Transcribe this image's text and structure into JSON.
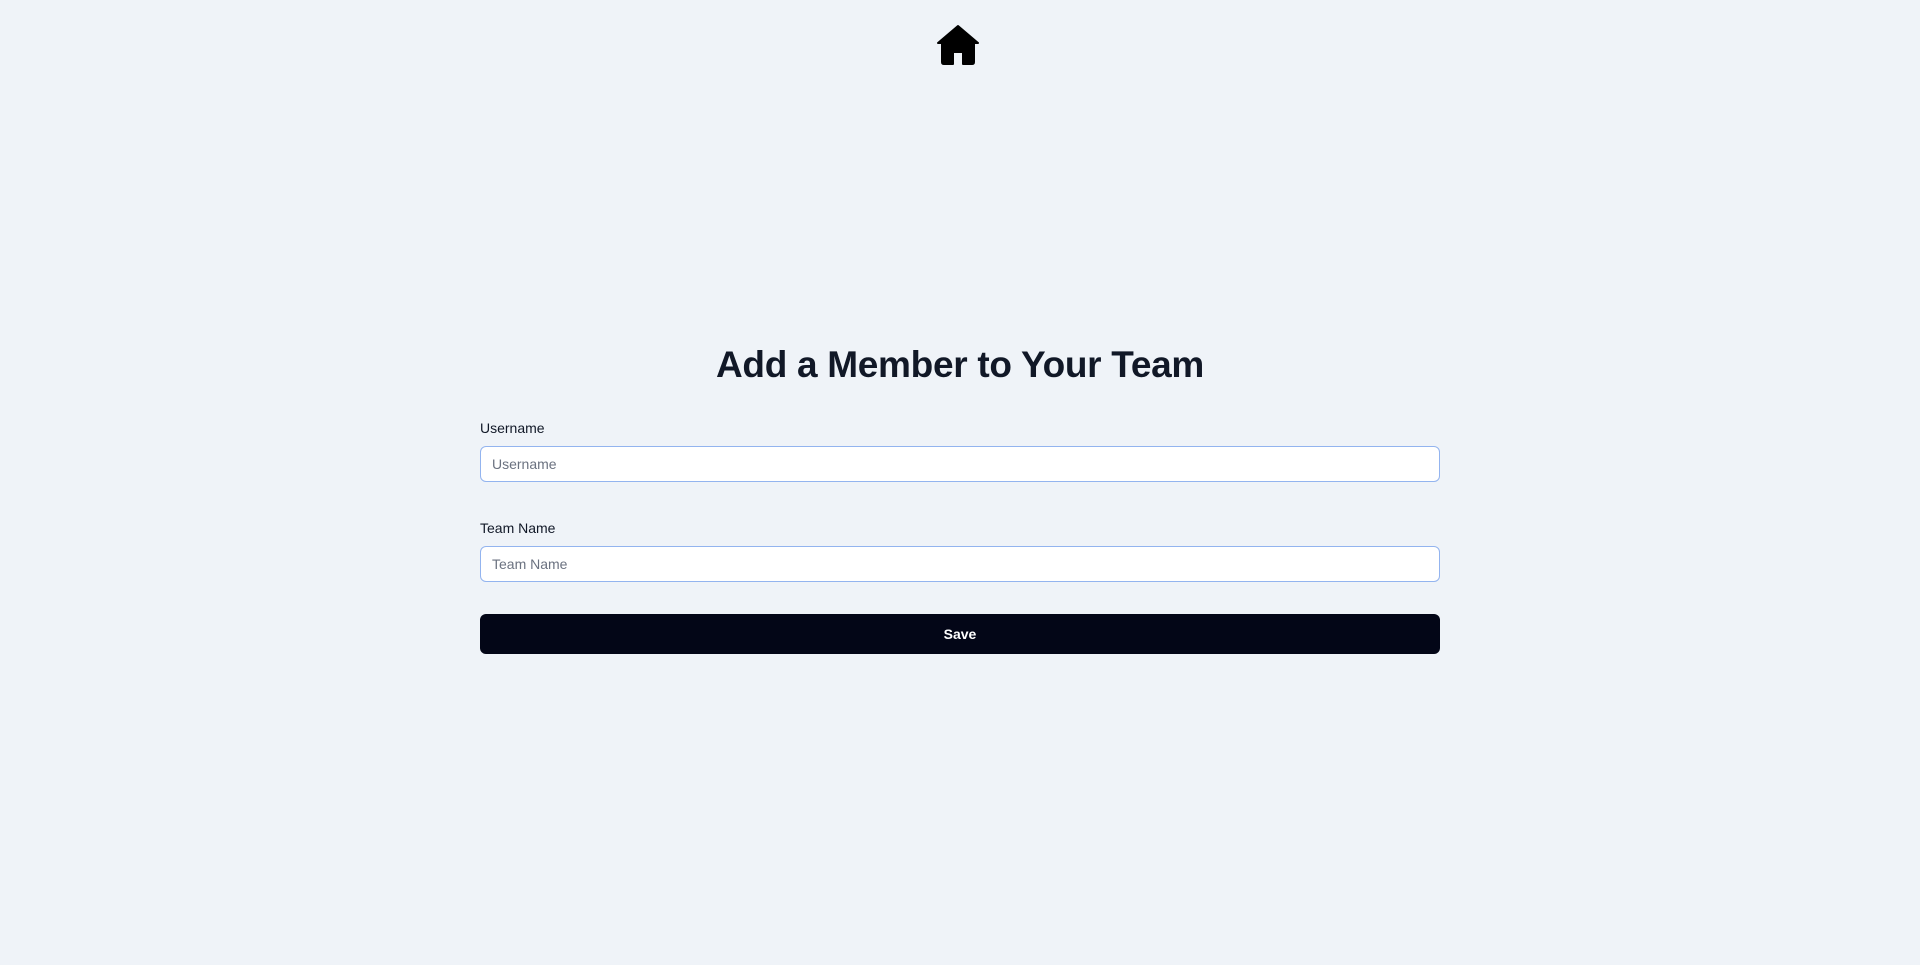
{
  "nav": {
    "home_icon": "home-icon"
  },
  "form": {
    "title": "Add a Member to Your Team",
    "username": {
      "label": "Username",
      "placeholder": "Username",
      "value": ""
    },
    "team_name": {
      "label": "Team Name",
      "placeholder": "Team Name",
      "value": ""
    },
    "save_label": "Save"
  },
  "colors": {
    "background": "#eff3f8",
    "button": "#030617",
    "input_border": "#93b4ef",
    "title": "#111827"
  }
}
